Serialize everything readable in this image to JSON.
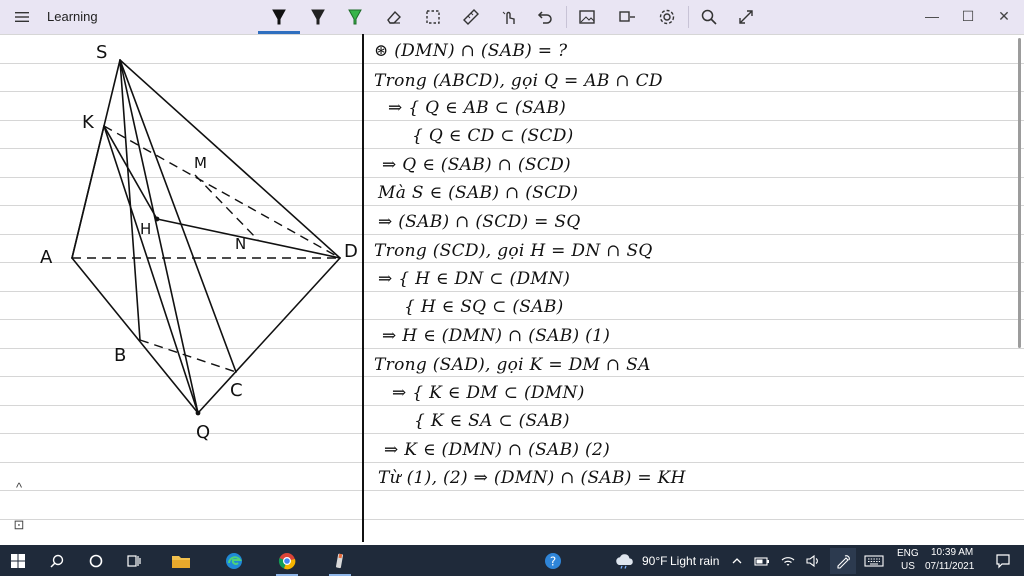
{
  "app": {
    "title": "Learning",
    "menu_icon": "hamburger-icon"
  },
  "toolbar": {
    "tools": [
      {
        "name": "pen-black-icon",
        "color": "#000000",
        "active": true
      },
      {
        "name": "pen-dark-icon",
        "color": "#111111"
      },
      {
        "name": "highlighter-green-icon",
        "color": "#38b449"
      },
      {
        "name": "eraser-icon"
      },
      {
        "name": "lasso-select-icon"
      },
      {
        "name": "ruler-icon"
      },
      {
        "name": "touch-writing-icon"
      },
      {
        "name": "undo-icon"
      },
      {
        "name": "insert-image-icon"
      },
      {
        "name": "insert-shape-icon"
      },
      {
        "name": "settings-icon"
      },
      {
        "name": "zoom-icon"
      },
      {
        "name": "fullscreen-icon"
      }
    ]
  },
  "window_controls": {
    "minimize": "—",
    "maximize": "☐",
    "close": "✕"
  },
  "figure": {
    "labels": {
      "S": "S",
      "K": "K",
      "M": "M",
      "H": "H",
      "N": "N",
      "A": "A",
      "D": "D",
      "B": "B",
      "C": "C",
      "Q": "Q"
    }
  },
  "notes": {
    "lines": [
      "⊛ (DMN) ∩ (SAB) = ?",
      "Trong (ABCD), gọi Q = AB ∩ CD",
      "⇒ { Q ∈ AB ⊂ (SAB)",
      "{ Q ∈ CD ⊂ (SCD)",
      "⇒ Q ∈ (SAB) ∩ (SCD)",
      "Mà S ∈ (SAB) ∩ (SCD)",
      "⇒ (SAB) ∩ (SCD) = SQ",
      "Trong (SCD), gọi H = DN ∩ SQ",
      "⇒ { H ∈ DN ⊂ (DMN)",
      "{ H ∈ SQ ⊂ (SAB)",
      "⇒ H ∈ (DMN) ∩ (SAB) (1)",
      "Trong (SAD), gọi K = DM ∩ SA",
      "⇒ { K ∈ DM ⊂ (DMN)",
      "{ K ∈ SA ⊂ (SAB)",
      "⇒ K ∈ (DMN) ∩ (SAB) (2)",
      "Từ (1), (2) ⇒ (DMN) ∩ (SAB) = KH"
    ]
  },
  "side_controls": {
    "collapse": "^",
    "fit": "⊡"
  },
  "taskbar": {
    "weather_temp": "90°F",
    "weather_text": "Light rain",
    "lang_top": "ENG",
    "lang_bottom": "US",
    "time": "10:39 AM",
    "date": "07/11/2021"
  }
}
